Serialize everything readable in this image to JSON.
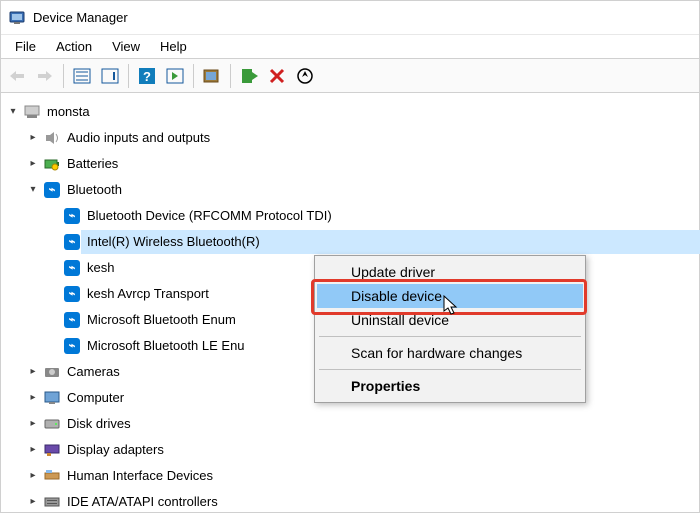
{
  "window": {
    "title": "Device Manager"
  },
  "menus": {
    "file": "File",
    "action": "Action",
    "view": "View",
    "help": "Help"
  },
  "tree": {
    "root": "monsta",
    "audio": "Audio inputs and outputs",
    "batteries": "Batteries",
    "bluetooth": "Bluetooth",
    "bt_rfcomm": "Bluetooth Device (RFCOMM Protocol TDI)",
    "bt_intel": "Intel(R) Wireless Bluetooth(R)",
    "bt_kesh": "kesh",
    "bt_kesh_avrcp": "kesh Avrcp Transport",
    "bt_enum": "Microsoft Bluetooth Enum",
    "bt_le": "Microsoft Bluetooth LE Enu",
    "cameras": "Cameras",
    "computer": "Computer",
    "disk": "Disk drives",
    "display": "Display adapters",
    "hid": "Human Interface Devices",
    "ide": "IDE ATA/ATAPI controllers"
  },
  "context": {
    "update": "Update driver",
    "disable": "Disable device",
    "uninstall": "Uninstall device",
    "scan": "Scan for hardware changes",
    "properties": "Properties"
  }
}
